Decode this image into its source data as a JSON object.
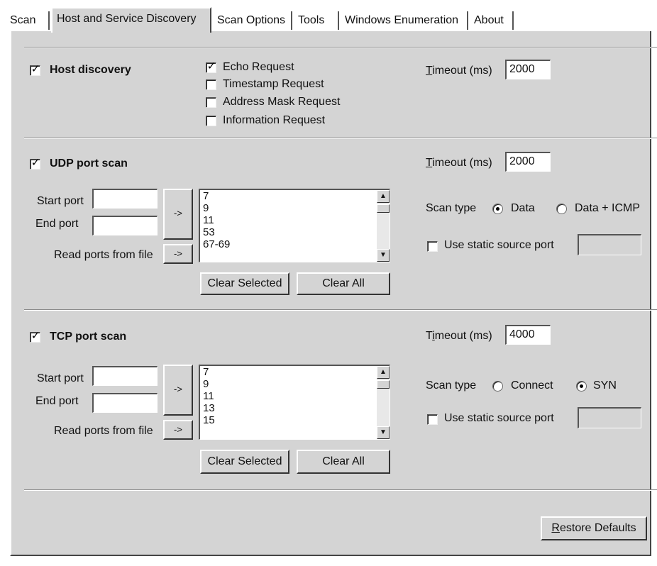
{
  "tabs": [
    {
      "label": "Scan"
    },
    {
      "label": "Host and Service Discovery"
    },
    {
      "label": "Scan Options"
    },
    {
      "label": "Tools"
    },
    {
      "label": "Windows Enumeration"
    },
    {
      "label": "About"
    }
  ],
  "host": {
    "title": "Host discovery",
    "checked": true,
    "options": [
      {
        "label": "Echo Request",
        "checked": true
      },
      {
        "label": "Timestamp Request",
        "checked": false
      },
      {
        "label": "Address Mask Request",
        "checked": false
      },
      {
        "label": "Information Request",
        "checked": false
      }
    ],
    "timeout_label_ul": "T",
    "timeout_label_rest": "imeout (ms)",
    "timeout_value": "2000"
  },
  "udp": {
    "title": "UDP port scan",
    "checked": true,
    "timeout_label_ul": "T",
    "timeout_label_rest": "imeout (ms)",
    "timeout_value": "2000",
    "start_port_label": "Start port",
    "end_port_label": "End port",
    "read_ports_label": "Read ports from file",
    "add_btn": "->",
    "file_btn": "->",
    "ports": [
      "7",
      "9",
      "11",
      "53",
      "67-69"
    ],
    "clear_selected": "Clear Selected",
    "clear_all": "Clear All",
    "scan_type_label": "Scan type",
    "scan_type_options": [
      {
        "label": "Data",
        "selected": true
      },
      {
        "label": "Data + ICMP",
        "selected": false
      }
    ],
    "static_port_label": "Use static source port",
    "static_port_checked": false
  },
  "tcp": {
    "title": "TCP port scan",
    "checked": true,
    "timeout_label_pre": "T",
    "timeout_label_ul": "i",
    "timeout_label_rest": "meout (ms)",
    "timeout_value": "4000",
    "start_port_label": "Start port",
    "end_port_label": "End port",
    "read_ports_label": "Read ports from file",
    "add_btn": "->",
    "file_btn": "->",
    "ports": [
      "7",
      "9",
      "11",
      "13",
      "15"
    ],
    "clear_selected": "Clear Selected",
    "clear_all": "Clear All",
    "scan_type_label": "Scan type",
    "scan_type_options": [
      {
        "label": "Connect",
        "selected": false
      },
      {
        "label": "SYN",
        "selected": true
      }
    ],
    "static_port_label": "Use static source port",
    "static_port_checked": false
  },
  "restore_defaults_ul": "R",
  "restore_defaults_rest": "estore Defaults",
  "icons": [
    "checkbox-tick-icon",
    "radio-dot-icon",
    "scroll-up-arrow-icon",
    "scroll-down-arrow-icon"
  ]
}
